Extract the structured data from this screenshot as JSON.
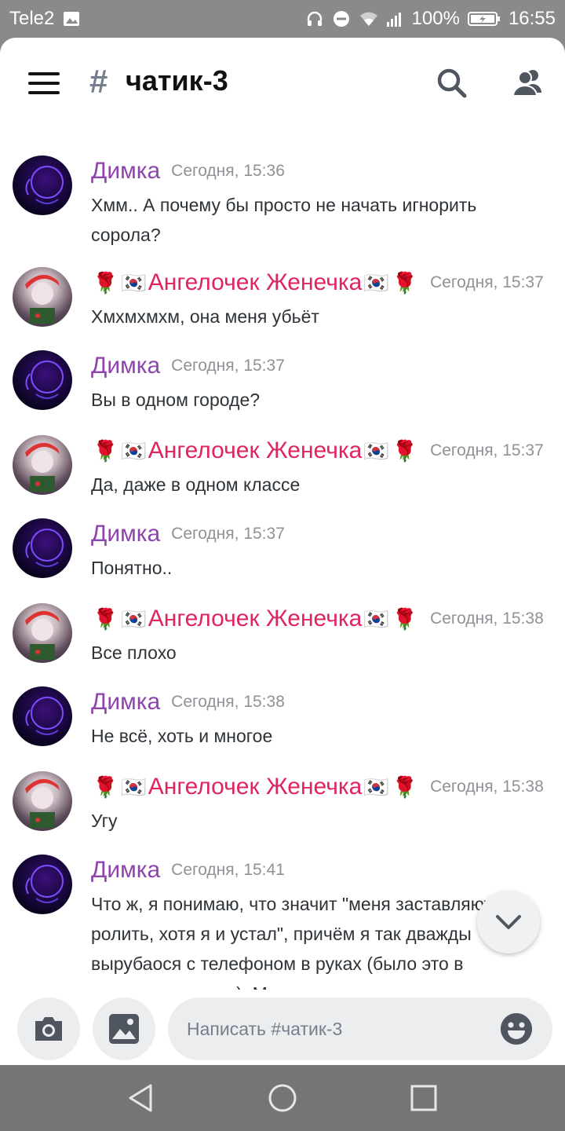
{
  "status_bar": {
    "carrier": "Tele2",
    "battery": "100%",
    "time": "16:55"
  },
  "header": {
    "hash": "#",
    "channel": "чатик-3"
  },
  "messages": [
    {
      "author": "Димка",
      "type": "dim",
      "time": "Сегодня, 15:36",
      "text": "Хмм.. А почему бы просто не начать игнорить сорола?"
    },
    {
      "author": "Ангелочек Женечка",
      "type": "angel",
      "time": "Сегодня, 15:37",
      "text": "Хмхмхмхм, она меня убьёт"
    },
    {
      "author": "Димка",
      "type": "dim",
      "time": "Сегодня, 15:37",
      "text": "Вы в одном городе?"
    },
    {
      "author": "Ангелочек Женечка",
      "type": "angel",
      "time": "Сегодня, 15:37",
      "text": "Да, даже в одном классе"
    },
    {
      "author": "Димка",
      "type": "dim",
      "time": "Сегодня, 15:37",
      "text": "Понятно.."
    },
    {
      "author": "Ангелочек Женечка",
      "type": "angel",
      "time": "Сегодня, 15:38",
      "text": "Все плохо"
    },
    {
      "author": "Димка",
      "type": "dim",
      "time": "Сегодня, 15:38",
      "text": "Не всё, хоть и многое"
    },
    {
      "author": "Ангелочек Женечка",
      "type": "angel",
      "time": "Сегодня, 15:38",
      "text": "Угу"
    },
    {
      "author": "Димка",
      "type": "dim",
      "time": "Сегодня, 15:41",
      "text": "Что ж, я понимаю, что значит \"меня заставляют ролить, хотя я и устал\", причём я так дважды вырубаося с телефоном в руках (было это в нынешнем летом). Меня просто заставляли"
    }
  ],
  "composer": {
    "placeholder": "Написать #чатик-3"
  },
  "colors": {
    "dim_author": "#8e44ad",
    "angel_author": "#e0245e",
    "timestamp": "#8e9297"
  },
  "icons": {
    "menu": "hamburger-icon",
    "search": "search-icon",
    "members": "members-icon",
    "camera": "camera-icon",
    "gallery": "image-icon",
    "emoji": "emoji-icon",
    "scroll": "chevron-down-icon"
  }
}
